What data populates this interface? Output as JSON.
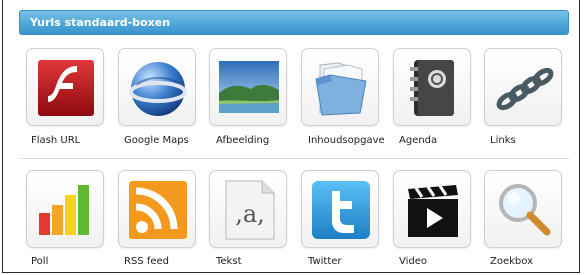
{
  "panel": {
    "title": "Yurls standaard-boxen"
  },
  "rows": [
    {
      "items": [
        {
          "label": "Flash URL",
          "icon": "flash-icon"
        },
        {
          "label": "Google Maps",
          "icon": "globe-icon"
        },
        {
          "label": "Afbeelding",
          "icon": "landscape-image-icon"
        },
        {
          "label": "Inhoudsopgave",
          "icon": "folder-icon"
        },
        {
          "label": "Agenda",
          "icon": "address-book-icon"
        },
        {
          "label": "Links",
          "icon": "chain-icon"
        }
      ]
    },
    {
      "items": [
        {
          "label": "Poll",
          "icon": "bar-chart-icon"
        },
        {
          "label": "RSS feed",
          "icon": "rss-icon"
        },
        {
          "label": "Tekst",
          "icon": "text-document-icon"
        },
        {
          "label": "Twitter",
          "icon": "twitter-icon"
        },
        {
          "label": "Video",
          "icon": "clapperboard-icon"
        },
        {
          "label": "Zoekbox",
          "icon": "magnifier-icon"
        }
      ]
    }
  ],
  "colors": {
    "header_top": "#7cc1e6",
    "header_bottom": "#3b95cc",
    "flash_red": "#c8141b",
    "rss_orange": "#f39a1e",
    "twitter_blue": "#2f9be0"
  }
}
